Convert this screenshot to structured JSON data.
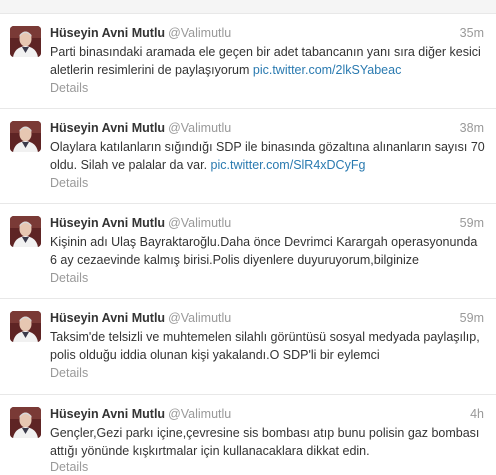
{
  "tweets": [
    {
      "name": "Hüseyin Avni Mutlu",
      "handle": "@Valimutlu",
      "time": "35m",
      "text": "Parti binasındaki aramada ele geçen bir adet tabancanın yanı sıra diğer kesici aletlerin resimlerini de paylaşıyorum",
      "link": "pic.twitter.com/2lkSYabeac",
      "details": "Details"
    },
    {
      "name": "Hüseyin Avni Mutlu",
      "handle": "@Valimutlu",
      "time": "38m",
      "text": "Olaylara katılanların sığındığı SDP ile binasında gözaltına alınanların sayısı 70 oldu. Silah ve palalar da var.",
      "link": "pic.twitter.com/SlR4xDCyFg",
      "details": "Details"
    },
    {
      "name": "Hüseyin Avni Mutlu",
      "handle": "@Valimutlu",
      "time": "59m",
      "text": "Kişinin adı Ulaş Bayraktaroğlu.Daha önce Devrimci Karargah operasyonunda 6 ay cezaevinde kalmış birisi.Polis diyenlere duyuruyorum,bilginize",
      "link": "",
      "details": "Details"
    },
    {
      "name": "Hüseyin Avni Mutlu",
      "handle": "@Valimutlu",
      "time": "59m",
      "text": "Taksim'de telsizli ve muhtemelen silahlı görüntüsü sosyal medyada paylaşılıp, polis olduğu iddia olunan kişi yakalandı.O SDP'li bir eylemci",
      "link": "",
      "details": "Details"
    },
    {
      "name": "Hüseyin Avni Mutlu",
      "handle": "@Valimutlu",
      "time": "4h",
      "text": "Gençler,Gezi parkı içine,çevresine sis bombası atıp bunu  polisin gaz bombası attığı yönünde kışkırtmalar için kullanacaklara dikkat edin.",
      "link": "",
      "details": "Details"
    }
  ]
}
